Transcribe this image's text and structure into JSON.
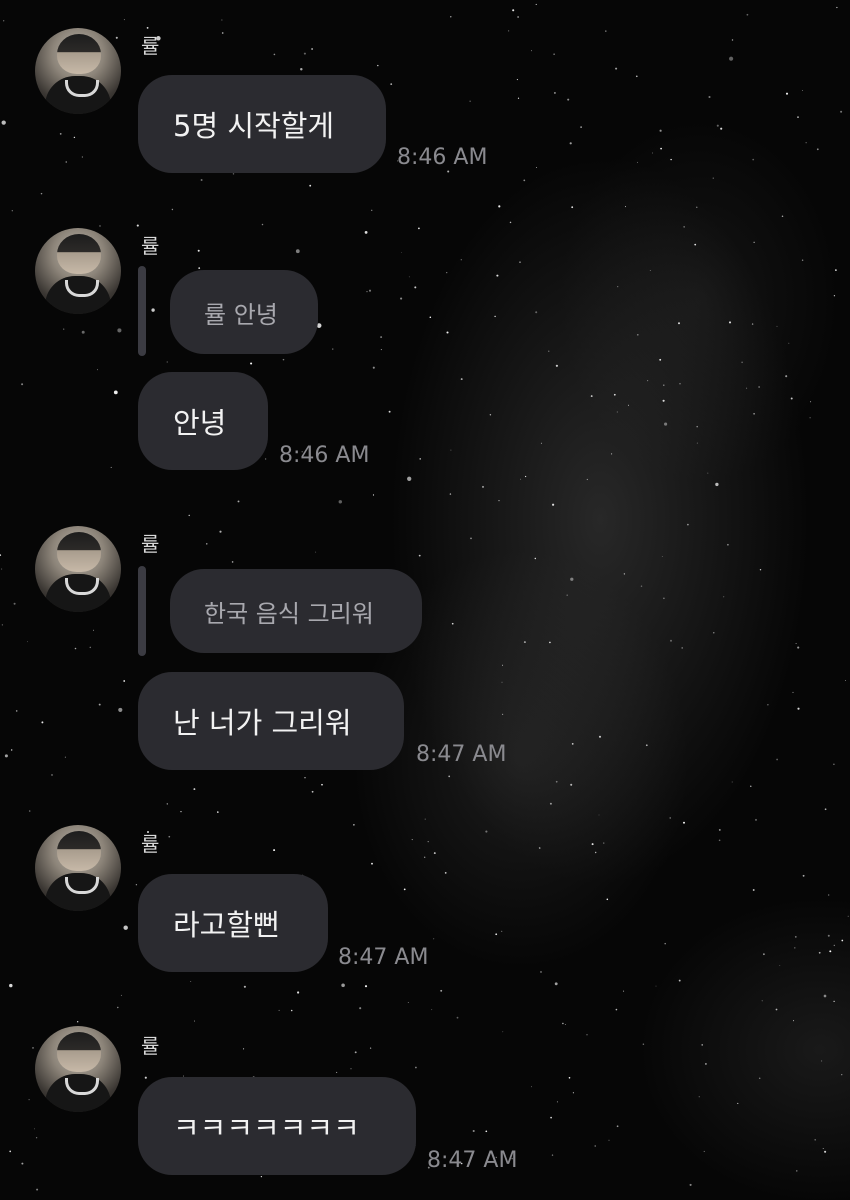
{
  "messages": [
    {
      "sender": "률",
      "text": "5명 시작할게",
      "time": "8:46 AM"
    },
    {
      "sender": "률",
      "reply_to": "률 안녕",
      "text": "안녕",
      "time": "8:46 AM"
    },
    {
      "sender": "률",
      "reply_to": "한국 음식 그리워",
      "text": "난 너가 그리워",
      "time": "8:47 AM"
    },
    {
      "sender": "률",
      "text": "라고할뻔",
      "time": "8:47 AM"
    },
    {
      "sender": "률",
      "text": "ㅋㅋㅋㅋㅋㅋㅋ",
      "time": "8:47 AM"
    }
  ],
  "theme": {
    "bubble_color": "#2b2b30",
    "text_color": "#f2f2f2",
    "time_color": "#8a8a8f",
    "background": "starry-night"
  }
}
